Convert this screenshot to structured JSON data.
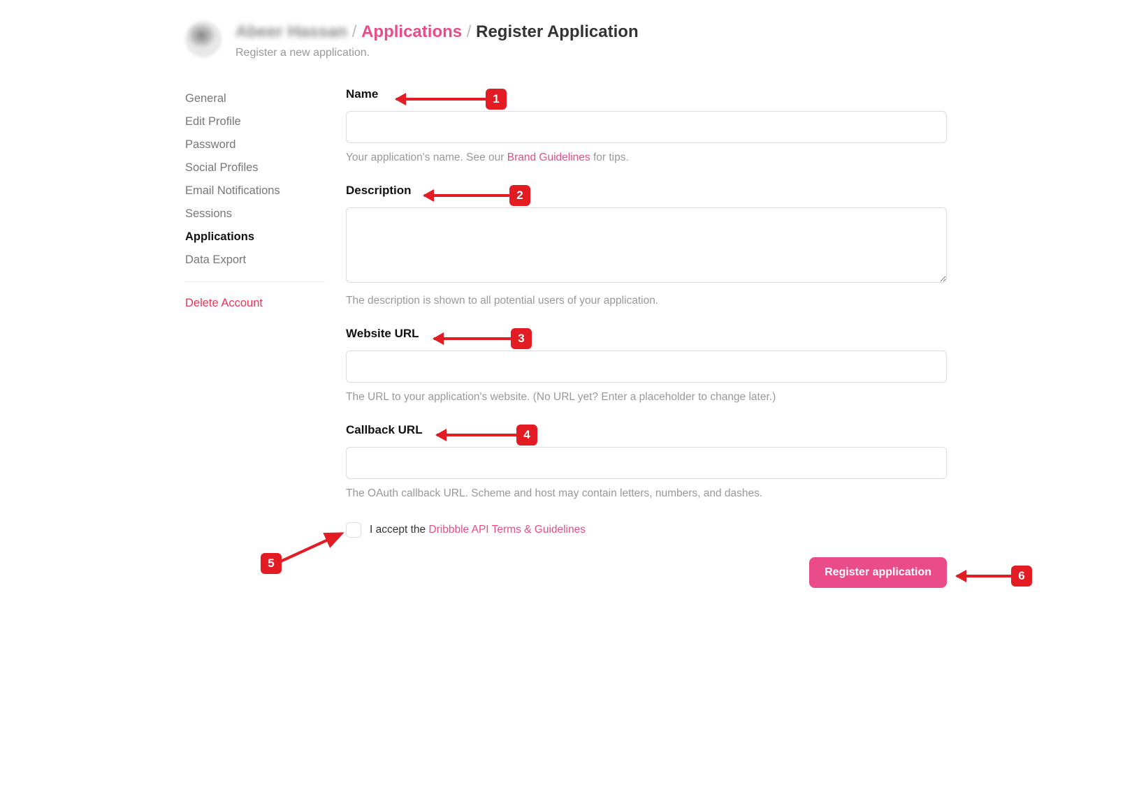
{
  "header": {
    "user_name_blurred": "Abeer Hassan",
    "crumb_applications": "Applications",
    "crumb_current": "Register Application",
    "subtitle": "Register a new application."
  },
  "sidebar": {
    "items": [
      {
        "label": "General",
        "active": false
      },
      {
        "label": "Edit Profile",
        "active": false
      },
      {
        "label": "Password",
        "active": false
      },
      {
        "label": "Social Profiles",
        "active": false
      },
      {
        "label": "Email Notifications",
        "active": false
      },
      {
        "label": "Sessions",
        "active": false
      },
      {
        "label": "Applications",
        "active": true
      },
      {
        "label": "Data Export",
        "active": false
      }
    ],
    "delete_label": "Delete Account"
  },
  "form": {
    "name": {
      "label": "Name",
      "value": "",
      "hint_prefix": "Your application's name. See our ",
      "hint_link": "Brand Guidelines",
      "hint_suffix": " for tips."
    },
    "description": {
      "label": "Description",
      "value": "",
      "hint": "The description is shown to all potential users of your application."
    },
    "website": {
      "label": "Website URL",
      "value": "",
      "hint": "The URL to your application's website. (No URL yet? Enter a placeholder to change later.)"
    },
    "callback": {
      "label": "Callback URL",
      "value": "",
      "hint": "The OAuth callback URL. Scheme and host may contain letters, numbers, and dashes."
    },
    "accept": {
      "prefix": "I accept the ",
      "link": "Dribbble API Terms & Guidelines"
    },
    "submit_label": "Register application"
  },
  "annotations": {
    "a1": "1",
    "a2": "2",
    "a3": "3",
    "a4": "4",
    "a5": "5",
    "a6": "6"
  }
}
